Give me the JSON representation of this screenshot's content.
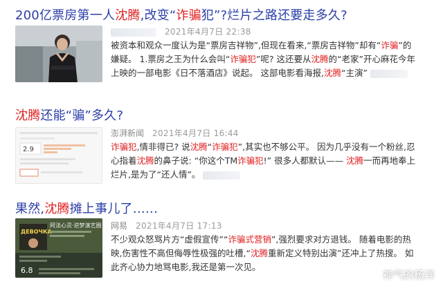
{
  "results": [
    {
      "title_parts": [
        "200亿票房第一人",
        "沈腾",
        ",改变“",
        "诈骗",
        "犯”?烂片之路还要走多久?"
      ],
      "source": "",
      "date": "2021年4月7日 22:38",
      "snippet_parts": [
        "被资本和观众一度认为是“票房吉祥物”,但现在看来,“票房吉祥物”却有“",
        "诈骗",
        "”的嫌疑。 1.票房之王为什么会叫“",
        "诈骗犯",
        "”呢? 这还要从",
        "沈腾",
        "的“老家”开心麻花今年上映的一部电影《日不落酒店》说起。 这部电影看海报,",
        "沈腾",
        "“主演”"
      ]
    },
    {
      "title_parts": [
        "沈腾",
        "还能“骗”多久?"
      ],
      "source": "澎湃新闻",
      "date": "2021年4月7日 16:44",
      "snippet_parts": [
        "诈骗犯",
        ",情非得已? 说",
        "沈腾",
        "“",
        "诈骗犯",
        "”,其实也不够公平。 因为几乎没有一个粉丝,忍心指着",
        "沈腾",
        "的鼻子说: “你这个TM",
        "诈骗犯",
        "!” 很多人都默认—— ",
        "沈腾",
        "一而再地奉上烂片,是为了“还人情”。"
      ]
    },
    {
      "title_parts": [
        "果然,",
        "沈腾",
        "摊上事儿了……"
      ],
      "source": "网易",
      "date": "2021年4月7日 17:13",
      "snippet_parts": [
        "不少观众怒骂片方“虚假宣传”“",
        "诈骗式营销",
        "”,强烈要求对方退钱。 随着电影的热映,伤害性不高但侮辱性极强的吐槽,“",
        "沈腾",
        "重新定义特别出演”还冲上了热搜。 如此齐心协力地骂电影,我还是第一次见。"
      ]
    }
  ],
  "thumb2": {
    "score": "2.9"
  },
  "thumb3": {
    "title": "阿法心灵·逆梦演艺圈",
    "score": "6.8"
  },
  "watermark": "神气的杨洋",
  "colors": {
    "title": "#2b3ea8",
    "highlight": "#e02020",
    "meta": "#9a9a9a",
    "text": "#333333"
  }
}
